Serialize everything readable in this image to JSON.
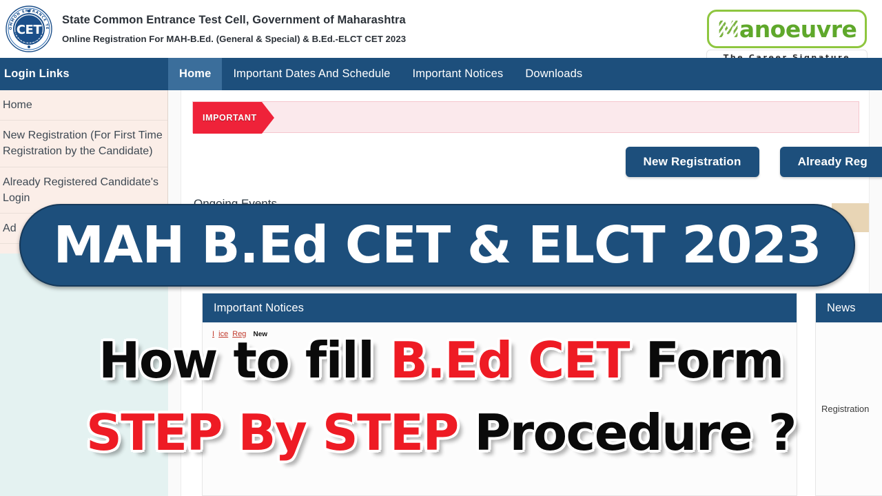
{
  "header": {
    "logo_alt": "CET",
    "title": "State Common Entrance Test Cell, Government of Maharashtra",
    "subtitle": "Online Registration For MAH-B.Ed. (General & Special) & B.Ed.-ELCT CET 2023",
    "logo_ring_text": "STATE COMMON ENTRANCE TEST CELL MAHARASHTRA"
  },
  "brand": {
    "name_prefix": "M",
    "name_rest": "anoeuvre",
    "tagline": "The Career Signature",
    "accent": "#8ec63f",
    "text_color": "#5fa82b"
  },
  "nav": {
    "login_links_label": "Login Links",
    "items": [
      {
        "label": "Home",
        "active": true
      },
      {
        "label": "Important Dates And Schedule",
        "active": false
      },
      {
        "label": "Important Notices",
        "active": false
      },
      {
        "label": "Downloads",
        "active": false
      }
    ],
    "bar_color": "#1d4f7c",
    "active_color": "#3b6e9b"
  },
  "sidebar": {
    "items": [
      {
        "label": "Home"
      },
      {
        "label": "New Registration (For First Time Registration by the Candidate)"
      },
      {
        "label": "Already Registered Candidate's Login"
      },
      {
        "label": "Ad"
      }
    ],
    "bg_color": "#fbeee8"
  },
  "main": {
    "important_banner": {
      "tag": "IMPORTANT",
      "tag_color": "#ef2239",
      "message": ""
    },
    "buttons": [
      {
        "label": "New Registration"
      },
      {
        "label": "Already Reg"
      }
    ],
    "ongoing_events_title": "Ongoing Events",
    "panels": {
      "notices": {
        "title": "Important Notices",
        "line_fragments": {
          "a": "I",
          "b": "ice",
          "c": "Reg",
          "new_badge": "New"
        }
      },
      "news": {
        "title": "News",
        "item": "Registration"
      }
    },
    "tan_band_color": "#e8d5b5"
  },
  "overlay": {
    "pill_text": "MAH B.Ed CET & ELCT 2023",
    "pill_color": "#1d4f7c",
    "headline_line1": [
      {
        "text": "How to fill ",
        "color": "black"
      },
      {
        "text": "B.Ed CET",
        "color": "red"
      },
      {
        "text": " Form",
        "color": "black"
      }
    ],
    "headline_line2": [
      {
        "text": "STEP By STEP",
        "color": "red"
      },
      {
        "text": " Procedure ?",
        "color": "black"
      }
    ],
    "red_color": "#ee1b24",
    "black_color": "#0a0a0a"
  }
}
